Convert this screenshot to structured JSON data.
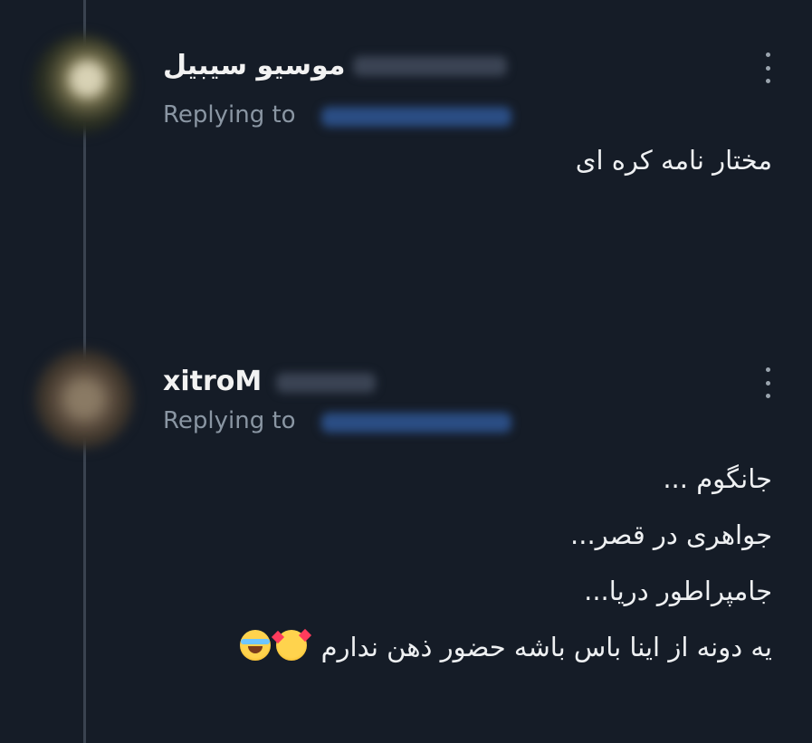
{
  "thread": {
    "tweets": [
      {
        "display_name": "موسیو سیبیل",
        "replying_label": "Replying to",
        "lines": [
          "مختار نامه کره ای"
        ]
      },
      {
        "display_name": "xitroM",
        "replying_label": "Replying to",
        "lines": [
          "جانگوم ...",
          "جواهری در قصر...",
          "جامپراطور دریا...",
          "یه دونه از اینا باس باشه حضور ذهن ندارم"
        ],
        "emojis": [
          "smiling-face-with-hearts",
          "face-with-tears-of-joy"
        ]
      }
    ]
  },
  "icons": {
    "more": "more-vertical-icon"
  },
  "colors": {
    "background": "#151c27",
    "text_primary": "#f2f2f2",
    "text_secondary": "#8a96a3",
    "mention_blur": "#2b4e85"
  }
}
